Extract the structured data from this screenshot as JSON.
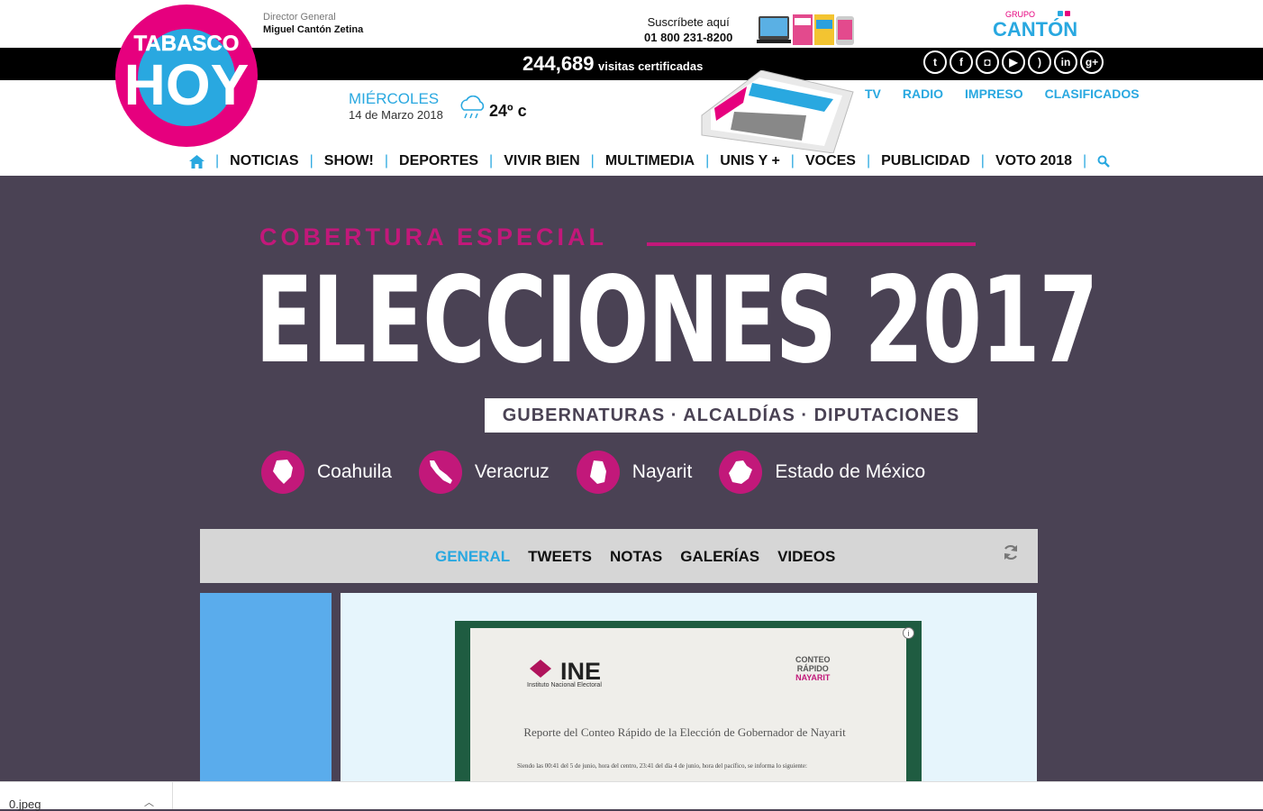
{
  "header": {
    "logo_top": "TABASCO",
    "logo_bottom": "HOY",
    "director_label": "Director General",
    "director_name": "Miguel Cantón Zetina",
    "subscribe_label": "Suscríbete aquí",
    "subscribe_phone": "01 800 231-8200",
    "group_small": "GRUPO",
    "group_name": "CANTÓN",
    "visits_number": "244,689",
    "visits_label": "visitas certificadas",
    "day": "MIÉRCOLES",
    "date": "14 de Marzo 2018",
    "temperature": "24º c",
    "top_links": [
      "TV",
      "RADIO",
      "IMPRESO",
      "CLASIFICADOS"
    ],
    "nav": [
      "NOTICIAS",
      "SHOW!",
      "DEPORTES",
      "VIVIR BIEN",
      "MULTIMEDIA",
      "UNIS Y +",
      "VOCES",
      "PUBLICIDAD",
      "VOTO 2018"
    ]
  },
  "social_icons": [
    "twitter-icon",
    "facebook-icon",
    "instagram-icon",
    "youtube-icon",
    "rss-icon",
    "linkedin-icon",
    "google-plus-icon"
  ],
  "hero": {
    "kicker": "COBERTURA ESPECIAL",
    "title": "ELECCIONES 2017",
    "subtitle": "GUBERNATURAS · ALCALDÍAS · DIPUTACIONES",
    "states": [
      "Coahuila",
      "Veracruz",
      "Nayarit",
      "Estado de México"
    ]
  },
  "tabs": [
    "GENERAL",
    "TWEETS",
    "NOTAS",
    "GALERÍAS",
    "VIDEOS"
  ],
  "active_tab": "GENERAL",
  "document": {
    "org": "INE",
    "org_full": "Instituto Nacional Electoral",
    "badge_line1": "CONTEO",
    "badge_line2": "RÁPIDO",
    "badge_line3": "NAYARIT",
    "heading": "Reporte del Conteo Rápido de la Elección de Gobernador de Nayarit",
    "body": "Siendo las 00:41 del 5 de junio, hora del centro, 23:41 del día 4 de junio, hora del pacífico, se informa lo siguiente:"
  },
  "download_bar": {
    "file": "0.jpeg"
  },
  "colors": {
    "accent_blue": "#29a8e0",
    "magenta": "#c2187a",
    "hero_bg": "#4a4254"
  }
}
